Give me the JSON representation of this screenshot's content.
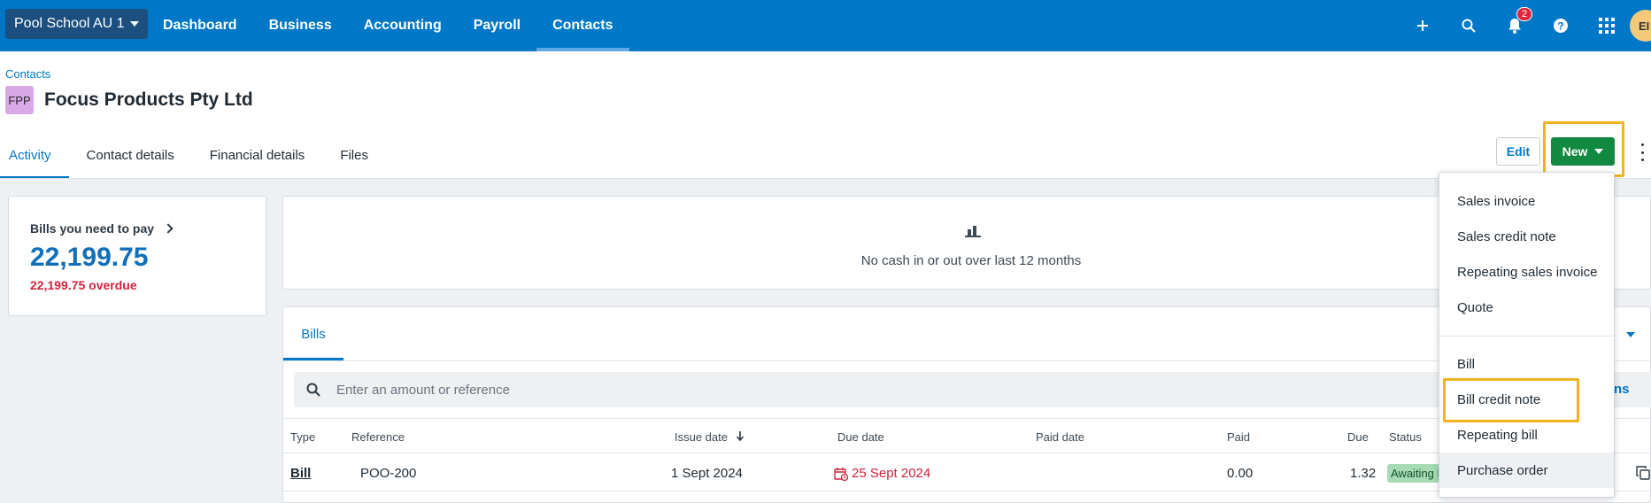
{
  "topbar": {
    "org_name": "Pool School AU 1",
    "nav": [
      "Dashboard",
      "Business",
      "Accounting",
      "Payroll",
      "Contacts"
    ],
    "active_nav": "Contacts",
    "notification_count": "2",
    "user_initials": "EI"
  },
  "header": {
    "breadcrumb": "Contacts",
    "avatar_initials": "FPP",
    "title": "Focus Products Pty Ltd",
    "tabs": [
      "Activity",
      "Contact details",
      "Financial details",
      "Files"
    ],
    "edit_label": "Edit",
    "new_label": "New"
  },
  "bills_card": {
    "title": "Bills you need to pay",
    "amount": "22,199.75",
    "overdue": "22,199.75 overdue"
  },
  "cash_card": {
    "message": "No cash in or out over last 12 months"
  },
  "table": {
    "tab": "Bills",
    "search_placeholder": "Enter an amount or reference",
    "columns_link": "ns",
    "headers": [
      "Type",
      "Reference",
      "Issue date",
      "Due date",
      "Paid date",
      "Paid",
      "Due",
      "Status"
    ],
    "row": {
      "type": "Bill",
      "reference": "POO-200",
      "issue_date": "1 Sept 2024",
      "due_date": "25 Sept 2024",
      "paid_date": "",
      "paid": "0.00",
      "due": "1.32",
      "status": "Awaiting P"
    }
  },
  "menu": {
    "items": [
      "Sales invoice",
      "Sales credit note",
      "Repeating sales invoice",
      "Quote",
      "Bill",
      "Bill credit note",
      "Repeating bill",
      "Purchase order"
    ]
  },
  "colors": {
    "brand_blue": "#0078c8",
    "new_green": "#128940",
    "overdue_red": "#d0223d",
    "highlight": "#f2b31f"
  }
}
